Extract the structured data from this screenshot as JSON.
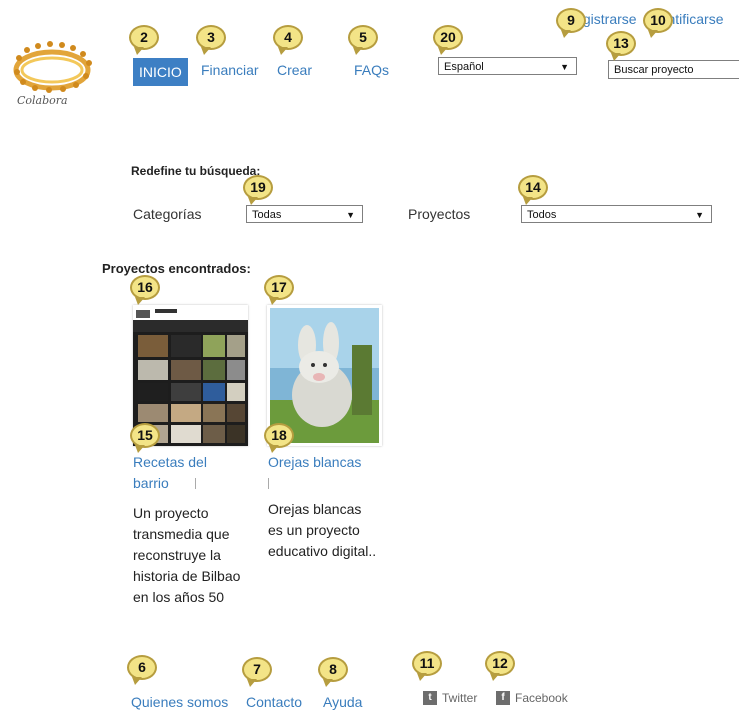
{
  "logo": {
    "text": "Colabora"
  },
  "nav": {
    "inicio": "INICIO",
    "financiar": "Financiar",
    "crear": "Crear",
    "faqs": "FAQs"
  },
  "header": {
    "language_selected": "Español",
    "registrarse": "Registrarse",
    "identificarse": "Identificarse",
    "search_placeholder": "Buscar proyecto"
  },
  "filters": {
    "title": "Redefine tu búsqueda:",
    "categorias_label": "Categorías",
    "categorias_selected": "Todas",
    "proyectos_label": "Proyectos",
    "proyectos_selected": "Todos"
  },
  "results": {
    "title": "Proyectos encontrados:",
    "projects": [
      {
        "title_line1": "Recetas del",
        "title_line2": "barrio",
        "desc": [
          "Un proyecto",
          "transmedia que",
          "reconstruye la",
          "historia de Bilbao",
          "en los años 50"
        ]
      },
      {
        "title_line1": "Orejas blancas",
        "desc": [
          "Orejas blancas",
          "es un proyecto",
          "educativo digital.."
        ]
      }
    ]
  },
  "footer": {
    "quienes": "Quienes somos",
    "contacto": "Contacto",
    "ayuda": "Ayuda",
    "twitter": "Twitter",
    "facebook": "Facebook"
  },
  "markers": [
    "2",
    "3",
    "4",
    "5",
    "20",
    "9",
    "10",
    "13",
    "19",
    "14",
    "16",
    "17",
    "15",
    "18",
    "6",
    "7",
    "8",
    "11",
    "12"
  ],
  "colors": {
    "link": "#3a7dbd",
    "active_nav": "#3d7fc4",
    "marker_fill": "#f3e487"
  }
}
